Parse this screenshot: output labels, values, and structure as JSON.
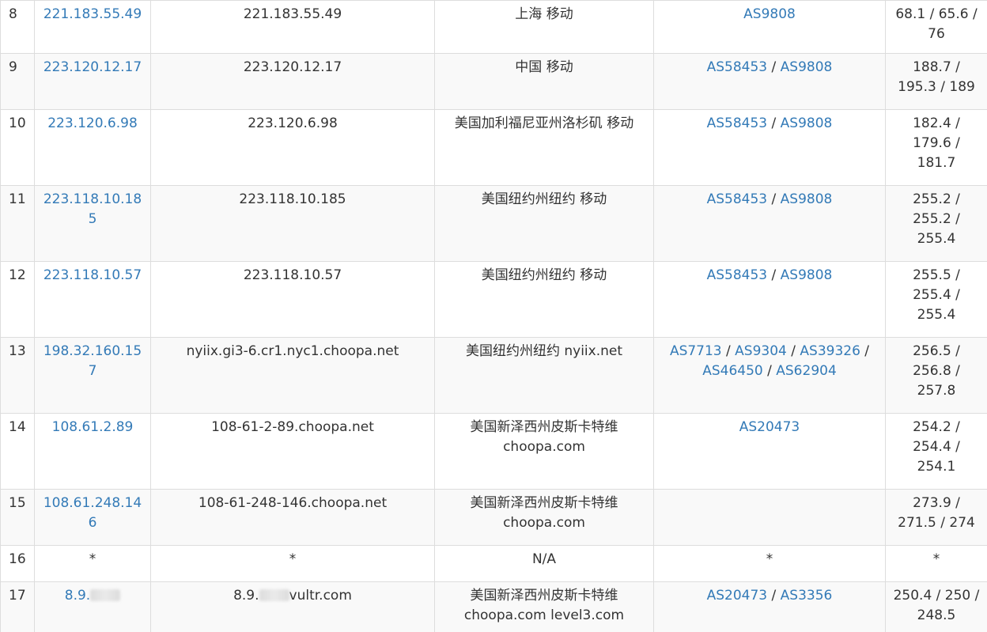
{
  "rows": [
    {
      "hop": "8",
      "ip": "221.183.55.49",
      "host": "221.183.55.49",
      "location": [
        "上海 移动"
      ],
      "asn": [
        [
          "AS9808"
        ]
      ],
      "latency": [
        "68.1 / 65.6 /",
        "76"
      ]
    },
    {
      "hop": "9",
      "ip": "223.120.12.17",
      "host": "223.120.12.17",
      "location": [
        "中国 移动"
      ],
      "asn": [
        [
          "AS58453",
          "AS9808"
        ]
      ],
      "latency": [
        "188.7 /",
        "195.3 / 189"
      ]
    },
    {
      "hop": "10",
      "ip": "223.120.6.98",
      "host": "223.120.6.98",
      "location": [
        "美国加利福尼亚州洛杉矶 移动"
      ],
      "asn": [
        [
          "AS58453",
          "AS9808"
        ]
      ],
      "latency": [
        "182.4 /",
        "179.6 /",
        "181.7"
      ]
    },
    {
      "hop": "11",
      "ip": "223.118.10.185",
      "host": "223.118.10.185",
      "location": [
        "美国纽约州纽约 移动"
      ],
      "asn": [
        [
          "AS58453",
          "AS9808"
        ]
      ],
      "latency": [
        "255.2 /",
        "255.2 /",
        "255.4"
      ]
    },
    {
      "hop": "12",
      "ip": "223.118.10.57",
      "host": "223.118.10.57",
      "location": [
        "美国纽约州纽约 移动"
      ],
      "asn": [
        [
          "AS58453",
          "AS9808"
        ]
      ],
      "latency": [
        "255.5 /",
        "255.4 /",
        "255.4"
      ]
    },
    {
      "hop": "13",
      "ip": "198.32.160.157",
      "host": "nyiix.gi3-6.cr1.nyc1.choopa.net",
      "location": [
        "美国纽约州纽约 nyiix.net"
      ],
      "asn": [
        [
          "AS7713",
          "AS9304",
          "AS39326"
        ],
        [
          "AS46450",
          "AS62904"
        ]
      ],
      "asn_trailing_sep": true,
      "latency": [
        "256.5 /",
        "256.8 /",
        "257.8"
      ]
    },
    {
      "hop": "14",
      "ip": "108.61.2.89",
      "host": "108-61-2-89.choopa.net",
      "location": [
        "美国新泽西州皮斯卡特维",
        "choopa.com"
      ],
      "asn": [
        [
          "AS20473"
        ]
      ],
      "latency": [
        "254.2 /",
        "254.4 /",
        "254.1"
      ]
    },
    {
      "hop": "15",
      "ip": "108.61.248.146",
      "host": "108-61-248-146.choopa.net",
      "location": [
        "美国新泽西州皮斯卡特维",
        "choopa.com"
      ],
      "asn": [],
      "latency": [
        "273.9 /",
        "271.5 / 274"
      ]
    },
    {
      "hop": "16",
      "ip": "*",
      "ip_plain": true,
      "host": "*",
      "location": [
        "N/A"
      ],
      "asn_text": "*",
      "asn": [],
      "latency": [
        "*"
      ]
    },
    {
      "hop": "17",
      "ip": "8.9.",
      "ip_redacted": true,
      "host": "8.9.",
      "host_suffix": "vultr.com",
      "host_redacted": true,
      "location": [
        "美国新泽西州皮斯卡特维",
        "choopa.com level3.com"
      ],
      "asn": [
        [
          "AS20473",
          "AS3356"
        ]
      ],
      "latency": [
        "250.4 / 250 /",
        "248.5"
      ]
    }
  ]
}
